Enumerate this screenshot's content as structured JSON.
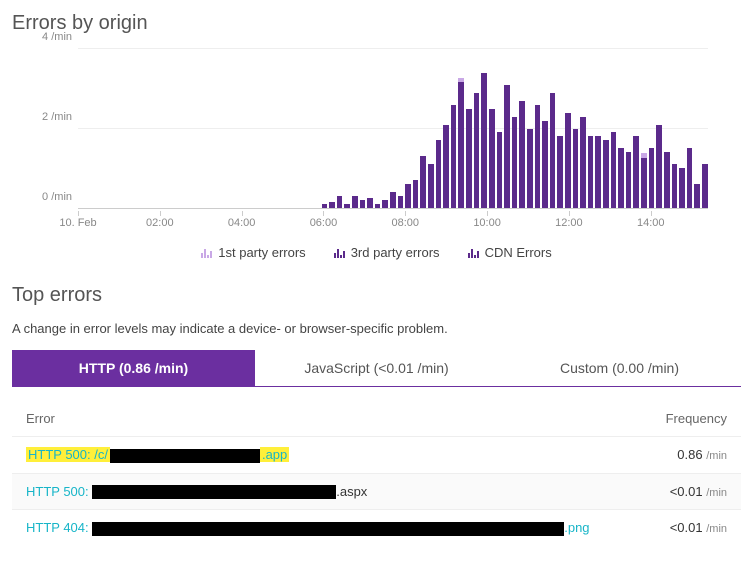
{
  "titles": {
    "errors_by_origin": "Errors by origin",
    "top_errors": "Top errors",
    "subtext": "A change in error levels may indicate a device- or browser-specific problem."
  },
  "chart_data": {
    "type": "bar",
    "title": "Errors by origin",
    "ylabel": "/min",
    "ylim": [
      0,
      4
    ],
    "y_ticks": [
      0,
      2,
      4
    ],
    "x_labels": [
      "10. Feb",
      "02:00",
      "04:00",
      "06:00",
      "08:00",
      "10:00",
      "12:00",
      "14:00"
    ],
    "series": [
      {
        "name": "1st party errors",
        "color": "#c9a8e6"
      },
      {
        "name": "3rd party errors",
        "color": "#5b2a8b"
      },
      {
        "name": "CDN Errors",
        "color": "#5b2a8b"
      }
    ],
    "values": [
      0,
      0,
      0,
      0,
      0,
      0,
      0,
      0,
      0,
      0,
      0,
      0,
      0,
      0,
      0,
      0,
      0,
      0,
      0,
      0,
      0,
      0,
      0,
      0,
      0,
      0,
      0,
      0,
      0,
      0,
      0,
      0,
      0.1,
      0.15,
      0.3,
      0.1,
      0.3,
      0.2,
      0.25,
      0.1,
      0.2,
      0.4,
      0.3,
      0.6,
      0.7,
      1.3,
      1.1,
      1.7,
      2.1,
      2.6,
      3.2,
      2.5,
      2.9,
      3.4,
      2.5,
      1.9,
      3.1,
      2.3,
      2.7,
      2.0,
      2.6,
      2.2,
      2.9,
      1.8,
      2.4,
      2.0,
      2.3,
      1.8,
      1.8,
      1.7,
      1.9,
      1.5,
      1.4,
      1.8,
      1.3,
      1.5,
      2.1,
      1.4,
      1.1,
      1.0,
      1.5,
      0.6,
      1.1
    ],
    "overlay_first_party": {
      "50": 0.15,
      "74": 0.25
    }
  },
  "legend": {
    "first": "1st party errors",
    "third": "3rd party errors",
    "cdn": "CDN Errors"
  },
  "tabs": [
    {
      "label": "HTTP (0.86 /min)",
      "active": true
    },
    {
      "label": "JavaScript (<0.01 /min)",
      "active": false
    },
    {
      "label": "Custom (0.00 /min)",
      "active": false
    }
  ],
  "table": {
    "head": {
      "error": "Error",
      "freq": "Frequency"
    },
    "rows": [
      {
        "prefix_hl": "HTTP 500: /c/",
        "mask_w": 150,
        "ext": ".app",
        "ext_hl": true,
        "freq": "0.86",
        "unit": "/min"
      },
      {
        "prefix": "HTTP 500: ",
        "mask_w": 244,
        "ext": ".aspx",
        "ext_dark": true,
        "freq": "<0.01",
        "unit": "/min"
      },
      {
        "prefix": "HTTP 404: ",
        "mask_w": 472,
        "ext": ".png",
        "freq": "<0.01",
        "unit": "/min"
      }
    ]
  }
}
